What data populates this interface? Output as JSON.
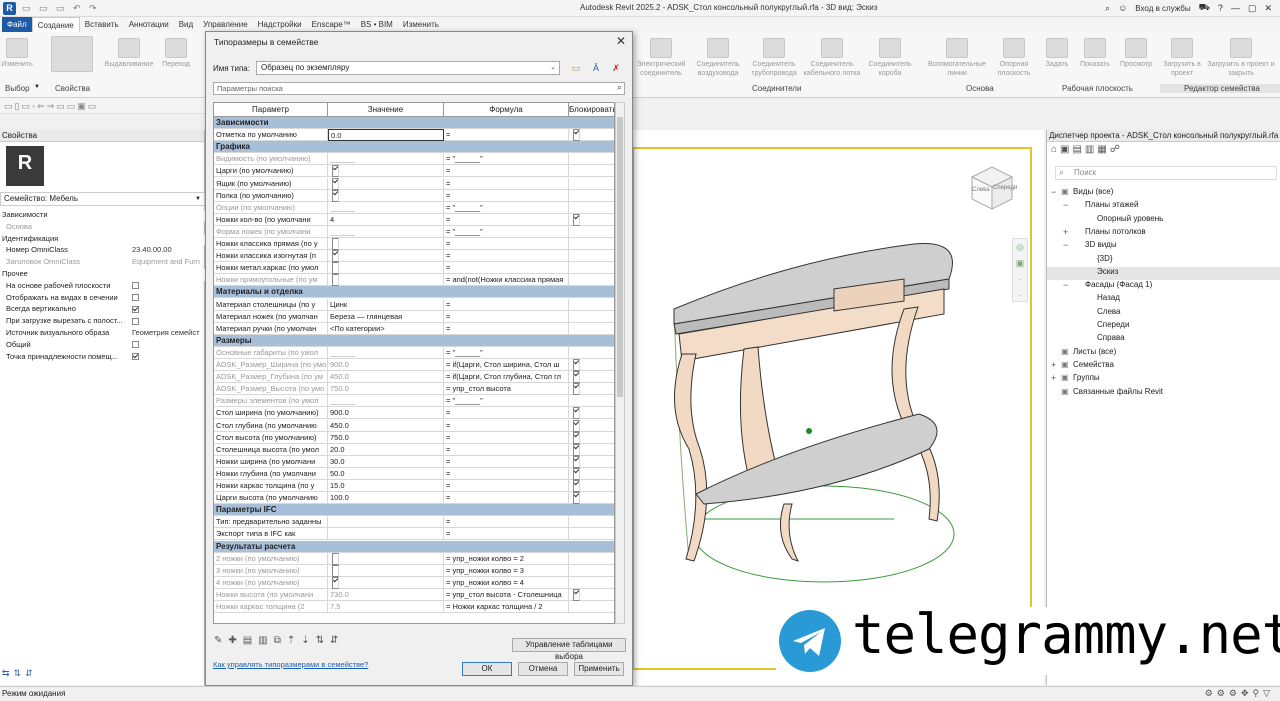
{
  "app": {
    "title": "Autodesk Revit 2025.2 - ADSK_Стол консольный полукруглый.rfa - 3D вид: Эскиз",
    "signin": "Вход в службы"
  },
  "menu": [
    "Файл",
    "Создание",
    "Вставить",
    "Аннотации",
    "Вид",
    "Управление",
    "Надстройки",
    "Enscape™",
    "BS • BIM",
    "Изменить"
  ],
  "ribbon": {
    "buttons": [
      "Изменить",
      "Выдавливание",
      "Переход",
      "Электрический соединитель",
      "Соединитель воздуховода",
      "Соединитель трубопровода",
      "Соединитель кабельного лотка",
      "Соединитель короба",
      "Вспомогательные линии",
      "Опорная плоскость",
      "Задать",
      "Показать",
      "Просмотр",
      "Загрузить в проект",
      "Загрузить в проект и закрыть"
    ],
    "sections": [
      "Выбор",
      "Свойства",
      "Соединители",
      "Основа",
      "Рабочая плоскость",
      "Редактор семейства"
    ]
  },
  "properties": {
    "header": "Свойства",
    "family": "Семейство: Мебель",
    "type_edit": "Изменить тип",
    "rows": [
      {
        "k": "Зависимости",
        "v": "",
        "h": true
      },
      {
        "k": "Основа",
        "v": "",
        "gray": true
      },
      {
        "k": "Идентификация",
        "v": "",
        "h": true
      },
      {
        "k": "Номер OmniClass",
        "v": "23.40.00.00"
      },
      {
        "k": "Заголовок OmniClass",
        "v": "Equipment and Furn",
        "gray": true
      },
      {
        "k": "Прочее",
        "v": "",
        "h": true
      },
      {
        "k": "На основе рабочей плоскости",
        "cb": false
      },
      {
        "k": "Отображать на видах в сечении",
        "cb": false
      },
      {
        "k": "Всегда вертикально",
        "cb": true
      },
      {
        "k": "При загрузке вырезать с полост...",
        "cb": false
      },
      {
        "k": "Источник визуального образа",
        "v": "Геометрия семейст"
      },
      {
        "k": "Общий",
        "cb": false
      },
      {
        "k": "Точка принадлежности помещ...",
        "cb": true
      }
    ]
  },
  "dialog": {
    "title": "Типоразмеры в семействе",
    "type_label": "Имя типа:",
    "type_value": "Образец по экземпляру",
    "search_placeholder": "Параметры поиска",
    "headers": [
      "Параметр",
      "Значение",
      "Формула",
      "Блокировать"
    ],
    "rows": [
      {
        "g": "Зависимости"
      },
      {
        "p": "Отметка по умолчанию",
        "v": "0.0",
        "f": "=",
        "l": true,
        "edit": true
      },
      {
        "g": "Графика"
      },
      {
        "p": "Видимость (по умолчанию)",
        "v": "______",
        "f": "= \"______\"",
        "gray": true
      },
      {
        "p": "Царги (по умолчанию)",
        "vcb": true,
        "f": "="
      },
      {
        "p": "Ящик (по умолчанию)",
        "vcb": true,
        "f": "="
      },
      {
        "p": "Полка (по умолчанию)",
        "vcb": true,
        "f": "="
      },
      {
        "p": "Опции (по умолчанию)",
        "v": "______",
        "f": "= \"______\"",
        "gray": true
      },
      {
        "p": "Ножки кол-во (по умолчани",
        "v": "4",
        "f": "=",
        "l": true
      },
      {
        "p": "Форма ножек (по умолчани",
        "v": "______",
        "f": "= \"______\"",
        "gray": true
      },
      {
        "p": "Ножки классика прямая (по у",
        "vcb": false,
        "f": "="
      },
      {
        "p": "Ножки классика изогнутая (п",
        "vcb": true,
        "f": "="
      },
      {
        "p": "Ножки метал.каркас (по умол",
        "vcb": false,
        "f": "="
      },
      {
        "p": "Ножки прямоугольные (по ум",
        "vcb": false,
        "f": "= and(not(Ножки классика прямая",
        "gray": true
      },
      {
        "g": "Материалы и отделка"
      },
      {
        "p": "Материал столешницы (по у",
        "v": "Цинк",
        "f": "="
      },
      {
        "p": "Материал ножек (по умолчан",
        "v": "Береза — глянцевая",
        "f": "="
      },
      {
        "p": "Материал ручки (по умолчан",
        "v": "<По категории>",
        "f": "="
      },
      {
        "g": "Размеры"
      },
      {
        "p": "Основные габариты (по умол",
        "v": "______",
        "f": "= \"______\"",
        "gray": true
      },
      {
        "p": "ADSK_Размер_Ширина (по умо",
        "v": "900.0",
        "f": "= if(Царги, Стол ширина, Стол ш",
        "l": true,
        "gray": true
      },
      {
        "p": "ADSK_Размер_Глубина (по ум",
        "v": "450.0",
        "f": "= if(Царги, Стол глубина, Стол гл",
        "l": true,
        "gray": true
      },
      {
        "p": "ADSK_Размер_Высота (по умо",
        "v": "750.0",
        "f": "= упр_стол высота",
        "l": true,
        "gray": true
      },
      {
        "p": "Размеры элементов (по умол",
        "v": "______",
        "f": "= \"______\"",
        "gray": true
      },
      {
        "p": "Стол ширина (по умолчанию)",
        "v": "900.0",
        "f": "=",
        "l": true
      },
      {
        "p": "Стол глубина (по умолчанию",
        "v": "450.0",
        "f": "=",
        "l": true
      },
      {
        "p": "Стол высота (по умолчанию)",
        "v": "750.0",
        "f": "=",
        "l": true
      },
      {
        "p": "Столешница высота (по умол",
        "v": "20.0",
        "f": "=",
        "l": true
      },
      {
        "p": "Ножки ширина (по умолчани",
        "v": "30.0",
        "f": "=",
        "l": true
      },
      {
        "p": "Ножки глубина (по умолчани",
        "v": "50.0",
        "f": "=",
        "l": true
      },
      {
        "p": "Ножки каркас толщина (по у",
        "v": "15.0",
        "f": "=",
        "l": true
      },
      {
        "p": "Царги высота (по умолчанию",
        "v": "100.0",
        "f": "=",
        "l": true
      },
      {
        "g": "Параметры IFC"
      },
      {
        "p": "Тип: предварительно заданны",
        "v": "",
        "f": "="
      },
      {
        "p": "Экспорт типа в IFC как",
        "v": "",
        "f": "="
      },
      {
        "g": "Результаты расчета"
      },
      {
        "p": "2 ножки (по умолчанию)",
        "vcb": false,
        "f": "= упр_ножки колво = 2",
        "gray": true
      },
      {
        "p": "3 ножки (по умолчанию)",
        "vcb": false,
        "f": "= упр_ножки колво = 3",
        "gray": true
      },
      {
        "p": "4 ножки (по умолчанию)",
        "vcb": true,
        "f": "= упр_ножки колво = 4",
        "gray": true
      },
      {
        "p": "Ножки высота (по умолчани",
        "v": "730.0",
        "f": "= упр_стол высота - Столешница",
        "l": true,
        "gray": true
      },
      {
        "p": "Ножки каркас толщина (2",
        "v": "7.5",
        "f": "= Ножки каркас толщина / 2",
        "gray": true
      }
    ],
    "manage_btn": "Управление таблицами выбора",
    "help_link": "Как управлять типоразмерами в семействе?",
    "ok": "ОК",
    "cancel": "Отмена",
    "apply": "Применить"
  },
  "browser": {
    "title": "Диспетчер проекта - ADSK_Стол консольный полукруглый.rfa",
    "search": "Поиск",
    "items": [
      {
        "t": "Виды (все)",
        "d": 0,
        "e": "−"
      },
      {
        "t": "Планы этажей",
        "d": 1,
        "e": "−"
      },
      {
        "t": "Опорный уровень",
        "d": 2
      },
      {
        "t": "Планы потолков",
        "d": 1,
        "e": "+"
      },
      {
        "t": "3D виды",
        "d": 1,
        "e": "−"
      },
      {
        "t": "{3D}",
        "d": 2
      },
      {
        "t": "Эскиз",
        "d": 2,
        "sel": true
      },
      {
        "t": "Фасады (Фасад 1)",
        "d": 1,
        "e": "−"
      },
      {
        "t": "Назад",
        "d": 2
      },
      {
        "t": "Слева",
        "d": 2
      },
      {
        "t": "Спереди",
        "d": 2
      },
      {
        "t": "Справа",
        "d": 2
      },
      {
        "t": "Листы (все)",
        "d": 0
      },
      {
        "t": "Семейства",
        "d": 0,
        "e": "+"
      },
      {
        "t": "Группы",
        "d": 0,
        "e": "+"
      },
      {
        "t": "Связанные файлы Revit",
        "d": 0
      }
    ]
  },
  "viewcube": {
    "left": "Слева",
    "front": "Спереди"
  },
  "status": "Режим ожидания",
  "watermark": "telegrammy.net"
}
